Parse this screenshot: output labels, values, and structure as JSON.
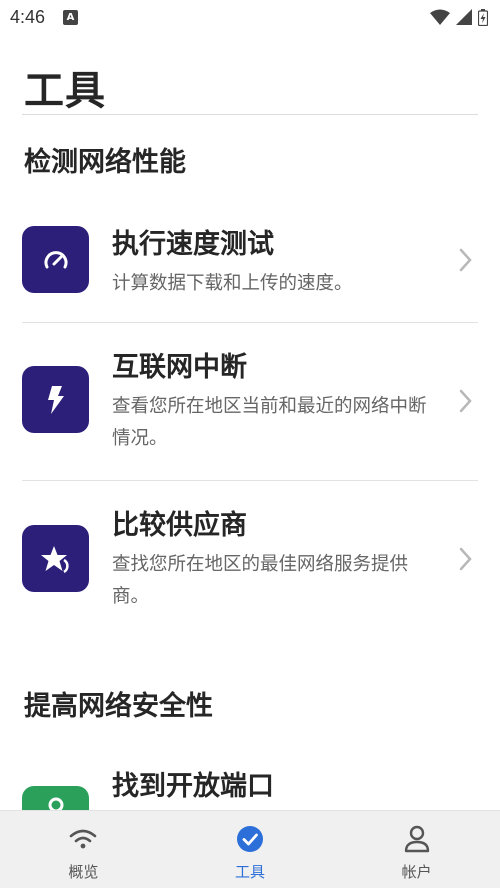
{
  "status": {
    "time": "4:46",
    "notification_icon": "a-notification-icon",
    "notification_glyph": "A"
  },
  "page": {
    "title": "工具"
  },
  "sections": [
    {
      "title": "检测网络性能",
      "items": [
        {
          "title": "执行速度测试",
          "description": "计算数据下载和上传的速度。",
          "icon": "speedometer-icon",
          "icon_bg": "#2b1f7a"
        },
        {
          "title": "互联网中断",
          "description": "查看您所在地区当前和最近的网络中断情况。",
          "icon": "lightning-icon",
          "icon_bg": "#2b1f7a"
        },
        {
          "title": "比较供应商",
          "description": "查找您所在地区的最佳网络服务提供商。",
          "icon": "star-rating-icon",
          "icon_bg": "#2b1f7a"
        }
      ]
    },
    {
      "title": "提高网络安全性",
      "items": [
        {
          "title": "找到开放端口",
          "description": "",
          "icon": "lock-icon",
          "icon_bg": "#2aa05a"
        }
      ]
    }
  ],
  "nav": {
    "items": [
      {
        "label": "概览",
        "icon": "wifi-icon"
      },
      {
        "label": "工具",
        "icon": "check-circle-icon",
        "active": true
      },
      {
        "label": "帐户",
        "icon": "person-icon"
      }
    ]
  },
  "colors": {
    "accent": "#2c6fd9",
    "icon_bg_purple": "#2b1f7a",
    "icon_bg_green": "#2aa05a"
  }
}
